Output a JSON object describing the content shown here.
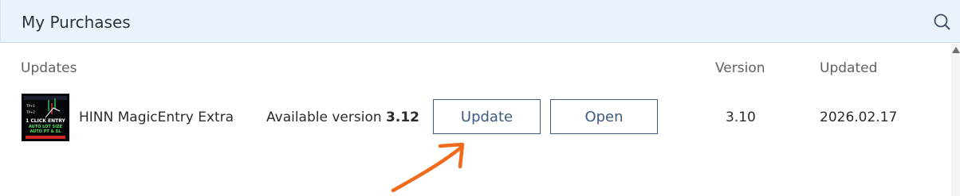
{
  "header": {
    "title": "My Purchases",
    "search_icon": "search-icon"
  },
  "columns": {
    "updates": "Updates",
    "version": "Version",
    "updated": "Updated"
  },
  "rows": [
    {
      "name": "HINN MagicEntry Extra",
      "available_prefix": "Available version ",
      "available_version": "3.12",
      "update_label": "Update",
      "open_label": "Open",
      "version": "3.10",
      "updated": "2026.02.17",
      "thumbnail": {
        "text_top": "1 CLICK ENTRY",
        "text_mid": "AUTO LOT SIZE",
        "text_bot": "AUTO PT & SL",
        "tags": [
          "TP+1",
          "TP+2"
        ]
      }
    }
  ],
  "colors": {
    "header_bg": "#eaf2fa",
    "button_border": "#3f5a7f",
    "annotation_arrow": "#f26a1b"
  }
}
